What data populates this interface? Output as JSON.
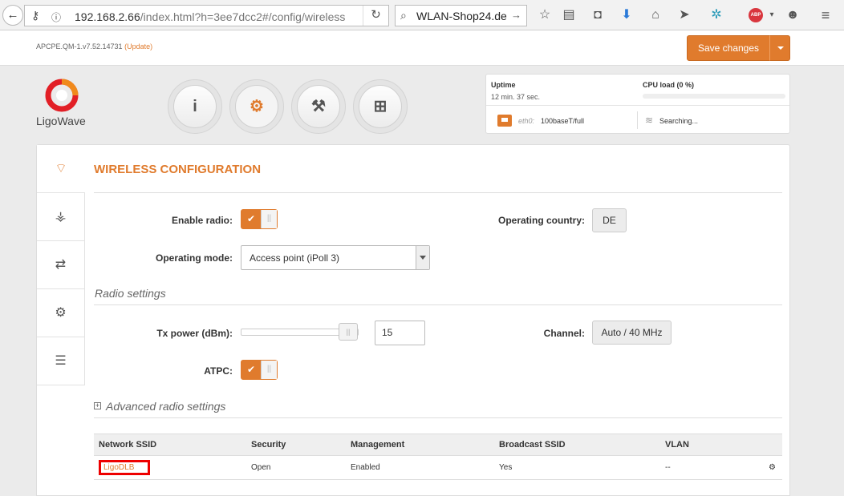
{
  "browser": {
    "url_host": "192.168.2.66",
    "url_path": "/index.html?h=3ee7dcc2#/config/wireless",
    "search_text": "WLAN-Shop24.de",
    "abp_label": "ABP"
  },
  "header": {
    "version": "APCPE.QM-1.v7.52.14731",
    "update_label": "(Update)",
    "save_label": "Save changes"
  },
  "logo": {
    "text": "LigoWave"
  },
  "nav": [
    {
      "name": "info",
      "icon": "i"
    },
    {
      "name": "settings",
      "icon": "⚙"
    },
    {
      "name": "tools",
      "icon": "⚒"
    },
    {
      "name": "support",
      "icon": "⊞"
    }
  ],
  "status": {
    "uptime_label": "Uptime",
    "uptime_value": "12 min. 37 sec.",
    "cpu_label": "CPU load (0 %)",
    "cpu_fraction": 0,
    "eth_name": "eth0:",
    "eth_value": "100baseT/full",
    "wireless_status": "Searching..."
  },
  "page": {
    "title": "WIRELESS CONFIGURATION"
  },
  "form": {
    "enable_radio_label": "Enable radio:",
    "enable_radio_on": true,
    "operating_country_label": "Operating country:",
    "operating_country_value": "DE",
    "operating_mode_label": "Operating mode:",
    "operating_mode_value": "Access point (iPoll 3)",
    "radio_settings_title": "Radio settings",
    "tx_power_label": "Tx power (dBm):",
    "tx_power_value": "15",
    "channel_label": "Channel:",
    "channel_value": "Auto / 40 MHz",
    "atpc_label": "ATPC:",
    "atpc_on": true,
    "advanced_title": "Advanced radio settings"
  },
  "table": {
    "headers": [
      "Network SSID",
      "Security",
      "Management",
      "Broadcast SSID",
      "VLAN"
    ],
    "rows": [
      {
        "ssid": "LigoDLB",
        "security": "Open",
        "management": "Enabled",
        "broadcast": "Yes",
        "vlan": "--"
      }
    ]
  },
  "colors": {
    "accent": "#e07b2d",
    "highlight_box": "#ee0000"
  }
}
